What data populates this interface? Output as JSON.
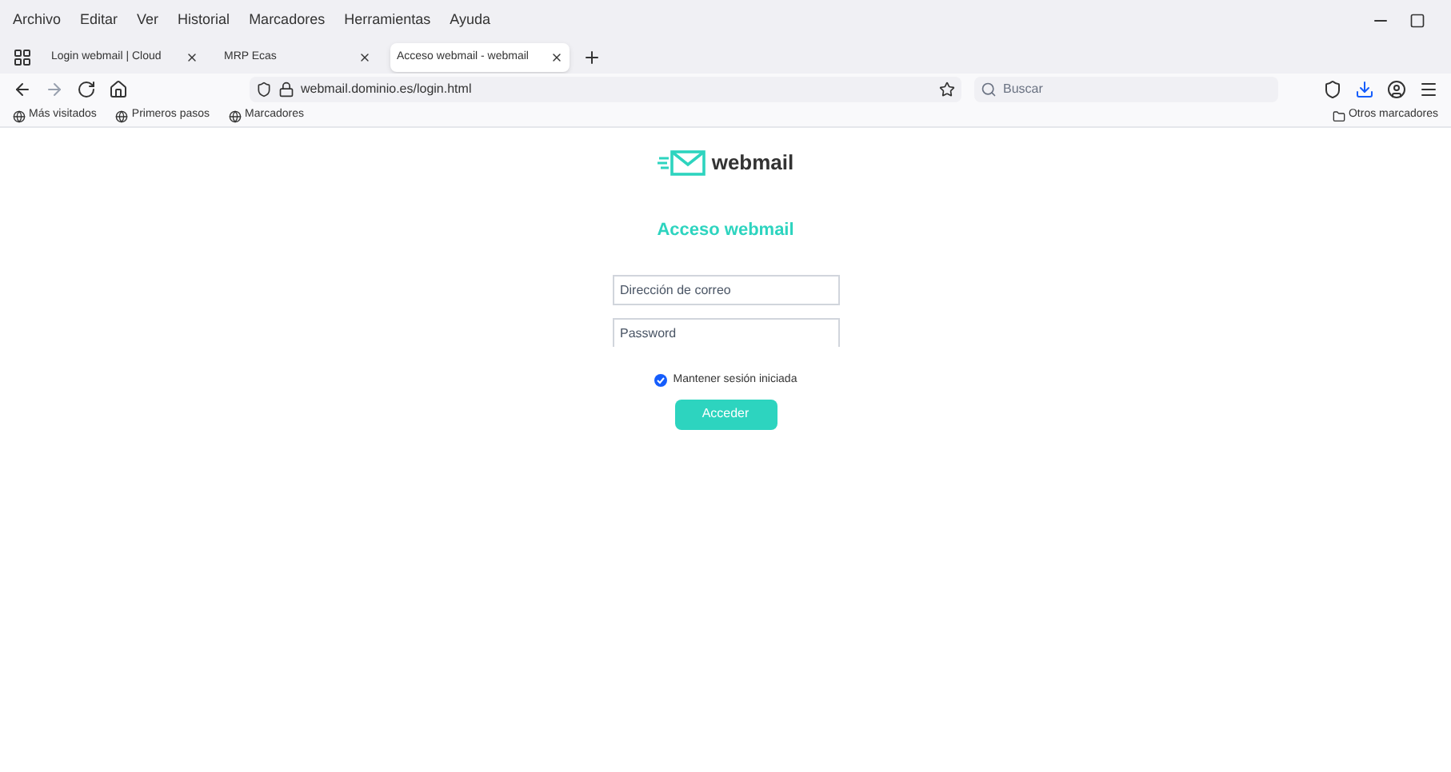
{
  "menu_bar": [
    "Archivo",
    "Editar",
    "Ver",
    "Historial",
    "Marcadores",
    "Herramientas",
    "Ayuda"
  ],
  "tabs": [
    {
      "label": "Login webmail | Cloud",
      "selected": false
    },
    {
      "label": "MRP Ecas",
      "selected": false
    },
    {
      "label": "Acceso webmail - webmail",
      "selected": true
    }
  ],
  "address_bar": {
    "url": "webmail.dominio.es/login.html"
  },
  "search": {
    "placeholder": "Buscar"
  },
  "bookmarks": [
    "Más visitados",
    "Primeros pasos",
    "Marcadores"
  ],
  "bookmarks_right": "Otros marcadores",
  "login": {
    "logo": "webmail",
    "title": "Acceso webmail",
    "email_placeholder": "Dirección de correo",
    "password_placeholder": "Password",
    "remember": {
      "label": "Mantener sesión iniciada",
      "checked": true
    },
    "button": "Acceder"
  }
}
